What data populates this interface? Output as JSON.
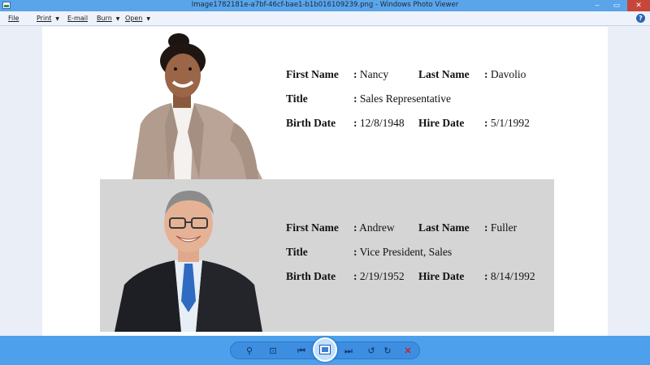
{
  "window": {
    "title": "Image1782181e-a7bf-46cf-bae1-b1b016109239.png - Windows Photo Viewer",
    "minimize_glyph": "–",
    "maximize_glyph": "▭",
    "close_glyph": "✕"
  },
  "menu": {
    "items": [
      {
        "label": "File"
      },
      {
        "label": "Print"
      },
      {
        "label": "E-mail"
      },
      {
        "label": "Burn"
      },
      {
        "label": "Open"
      }
    ],
    "help_glyph": "?"
  },
  "labels": {
    "first_name": "First Name",
    "last_name": "Last Name",
    "title": "Title",
    "birth_date": "Birth Date",
    "hire_date": "Hire Date",
    "separator": ":"
  },
  "employees": [
    {
      "first_name": "Nancy",
      "last_name": "Davolio",
      "title": "Sales Representative",
      "birth_date": "12/8/1948",
      "hire_date": "5/1/1992"
    },
    {
      "first_name": "Andrew",
      "last_name": "Fuller",
      "title": "Vice President, Sales",
      "birth_date": "2/19/1952",
      "hire_date": "8/14/1992"
    }
  ],
  "toolbar": {
    "zoom_glyph": "⚲",
    "fit_glyph": "⊡",
    "prev_glyph": "⏮",
    "next_glyph": "⏭",
    "rotate_ccw_glyph": "↺",
    "rotate_cw_glyph": "↻",
    "delete_glyph": "✕"
  },
  "colors": {
    "titlebar": "#5aa4ea",
    "toolbar": "#4da1ec",
    "record_alt_bg": "#d5d5d5"
  }
}
